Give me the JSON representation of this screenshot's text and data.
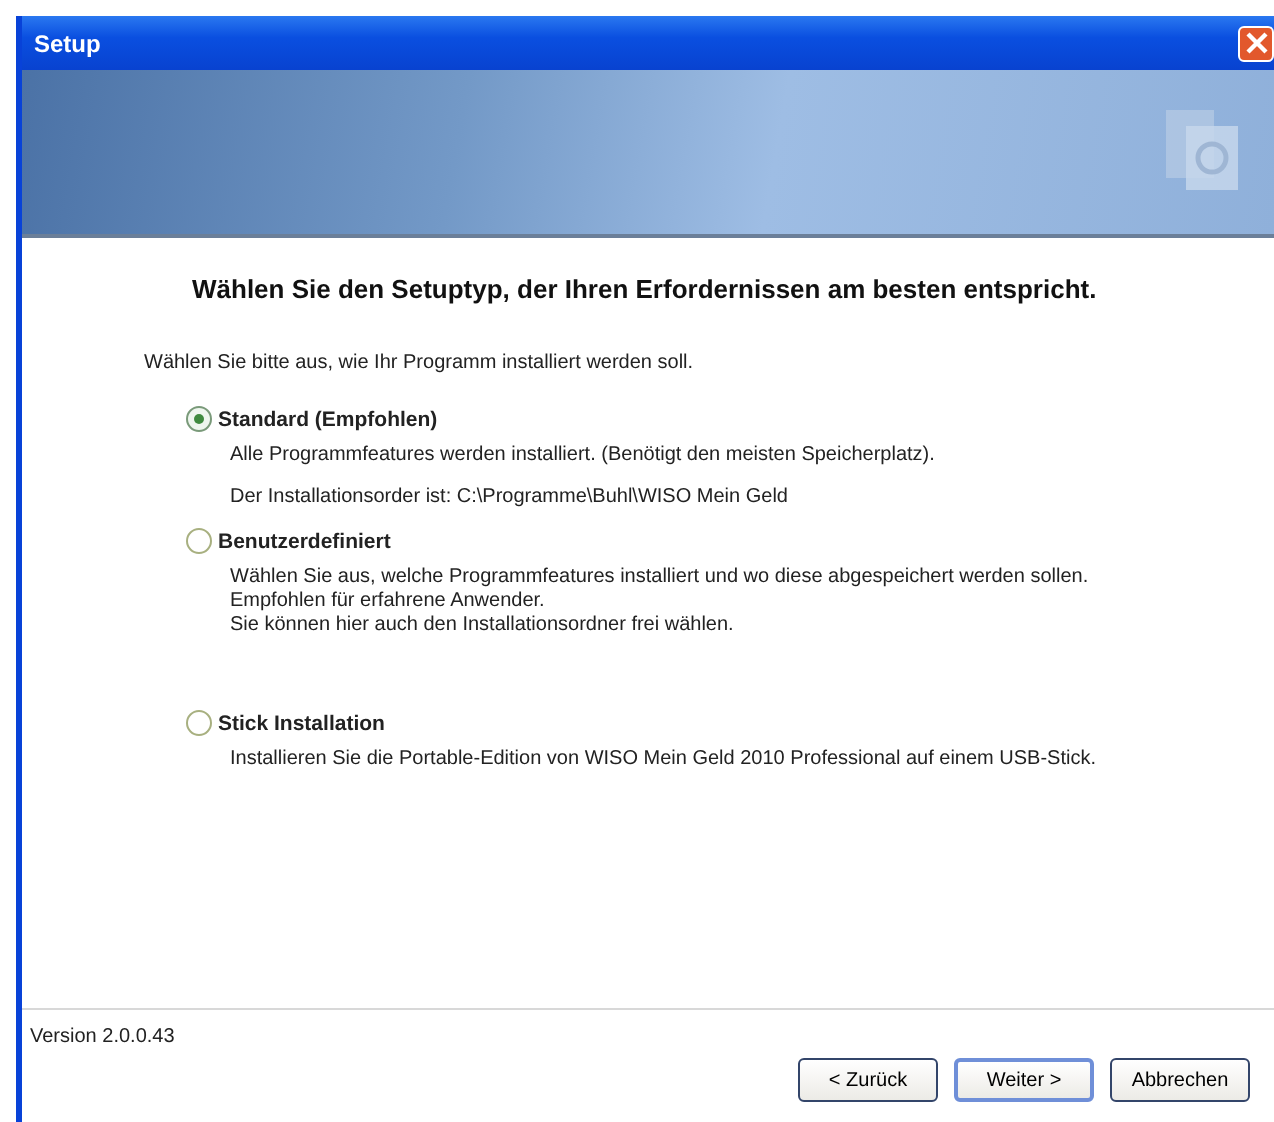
{
  "window": {
    "title": "Setup"
  },
  "heading": "Wählen Sie den Setuptyp, der Ihren Erfordernissen am besten entspricht.",
  "intro": "Wählen Sie bitte aus, wie Ihr Programm installiert werden soll.",
  "options": [
    {
      "label": "Standard (Empfohlen)",
      "selected": true,
      "paragraphs": [
        [
          "Alle Programmfeatures werden installiert. (Benötigt den meisten Speicherplatz)."
        ],
        [
          "Der Installationsorder ist: C:\\Programme\\Buhl\\WISO Mein Geld"
        ]
      ]
    },
    {
      "label": "Benutzerdefiniert",
      "selected": false,
      "paragraphs": [
        [
          "Wählen Sie aus, welche Programmfeatures installiert und wo diese abgespeichert werden sollen.",
          "Empfohlen für erfahrene Anwender.",
          "Sie können hier auch den Installationsordner frei wählen."
        ]
      ]
    },
    {
      "label": "Stick Installation",
      "selected": false,
      "paragraphs": [
        [
          "Installieren Sie die Portable-Edition von WISO Mein Geld 2010 Professional auf einem USB-Stick."
        ]
      ]
    }
  ],
  "version": "Version 2.0.0.43",
  "buttons": [
    {
      "label": "< Zurück",
      "default": false
    },
    {
      "label": "Weiter >",
      "default": true
    },
    {
      "label": "Abbrechen",
      "default": false
    }
  ]
}
